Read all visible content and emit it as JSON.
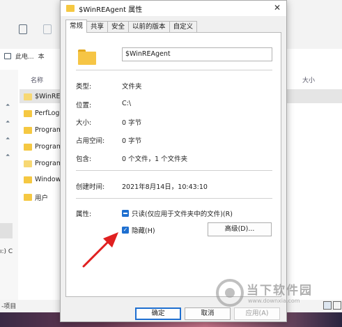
{
  "explorer": {
    "breadcrumb": [
      "此电...",
      "本"
    ],
    "col_name": "名称",
    "col_size": "大小",
    "rows": [
      "$WinREA",
      "PerfLogs",
      "Program",
      "Program",
      "Program",
      "Windows",
      "用户"
    ],
    "left_partial": "ı:) C",
    "status": "-项目"
  },
  "dialog": {
    "title": "$WinREAgent 属性",
    "tabs": [
      "常规",
      "共享",
      "安全",
      "以前的版本",
      "自定义"
    ],
    "name_value": "$WinREAgent",
    "fields": [
      {
        "label": "类型:",
        "value": "文件夹"
      },
      {
        "label": "位置:",
        "value": "C:\\"
      },
      {
        "label": "大小:",
        "value": "0 字节"
      },
      {
        "label": "占用空间:",
        "value": "0 字节"
      },
      {
        "label": "包含:",
        "value": "0 个文件，1 个文件夹"
      }
    ],
    "created_label": "创建时间:",
    "created_value": "2021年8月14日，10:43:10",
    "attributes_label": "属性:",
    "readonly_label": "只读(仅应用于文件夹中的文件)(R)",
    "hidden_label": "隐藏(H)",
    "advanced_label": "高级(D)...",
    "ok_label": "确定",
    "cancel_label": "取消",
    "apply_label": "应用(A)"
  },
  "watermark": {
    "text": "当下软件园",
    "url": "www.downxia.com"
  },
  "colors": {
    "accent": "#1e6fd0",
    "folder": "#f6c545",
    "arrow": "#e02020"
  }
}
